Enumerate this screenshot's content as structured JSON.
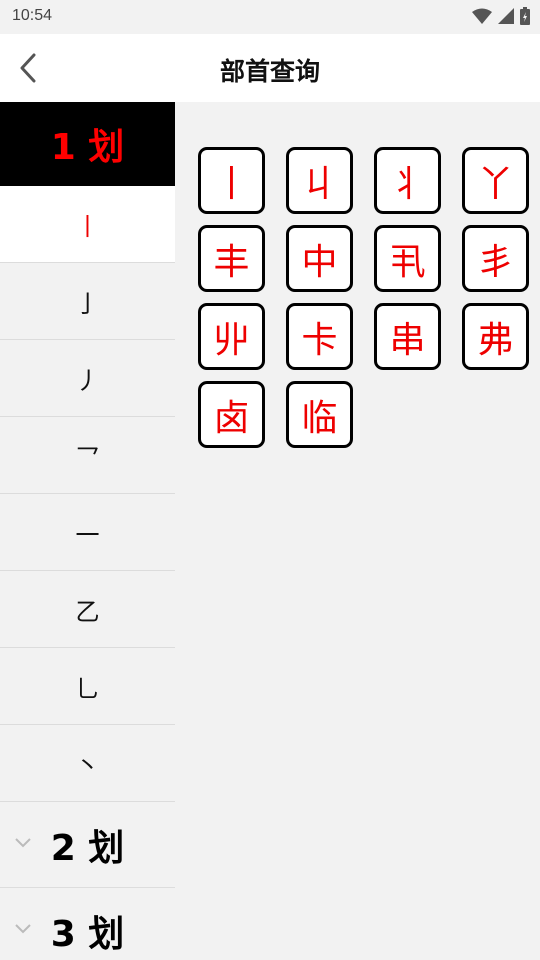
{
  "status": {
    "time": "10:54"
  },
  "app_bar": {
    "title": "部首查询"
  },
  "sidebar": {
    "active_group": "1 划",
    "strokes": [
      "丨",
      "亅",
      "丿",
      "乛",
      "一",
      "乙",
      "乚",
      "丶"
    ],
    "selected_index": 0,
    "collapsed_groups": [
      "2 划",
      "3 划"
    ]
  },
  "characters": [
    "丨",
    "丩",
    "丬",
    "丫",
    "丰",
    "中",
    "丮",
    "丯",
    "丱",
    "卡",
    "串",
    "弗",
    "卤",
    "临"
  ],
  "colors": {
    "accent": "#e00000",
    "active_bg": "#000000"
  }
}
